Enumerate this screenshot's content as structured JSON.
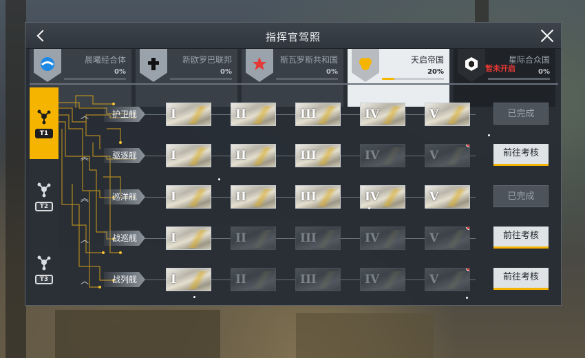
{
  "window": {
    "title": "指挥官驾照"
  },
  "factions": [
    {
      "name": "晨曦经合体",
      "pct": "0%",
      "fill": 0,
      "active": false,
      "emblem": "globe-emblem-icon"
    },
    {
      "name": "新欧罗巴联邦",
      "pct": "0%",
      "fill": 0,
      "active": false,
      "emblem": "cross-emblem-icon"
    },
    {
      "name": "斯瓦罗斯共和国",
      "pct": "0%",
      "fill": 0,
      "active": false,
      "emblem": "star-emblem-icon"
    },
    {
      "name": "天启帝国",
      "pct": "20%",
      "fill": 0.2,
      "active": true,
      "emblem": "circles-emblem-icon"
    },
    {
      "name": "星际合众国",
      "pct": "0%",
      "fill": 0,
      "active": false,
      "emblem": "hexagon-emblem-icon",
      "lock_text": "暂未开启"
    }
  ],
  "tiers": [
    {
      "badge": "T1",
      "active": true
    },
    {
      "badge": "T2",
      "active": false
    },
    {
      "badge": "T3",
      "active": false
    }
  ],
  "numerals": [
    "I",
    "II",
    "III",
    "IV",
    "V"
  ],
  "ships": [
    {
      "name": "护卫舰",
      "chevron": "︿",
      "unlocked": 5,
      "red_dot": null,
      "action": "已完成",
      "action_type": "done"
    },
    {
      "name": "驱逐舰",
      "chevron": "︽",
      "unlocked": 3,
      "red_dot": 4,
      "action": "前往考核",
      "action_type": "go"
    },
    {
      "name": "巡洋舰",
      "chevron": "︽",
      "unlocked": 5,
      "red_dot": null,
      "action": "已完成",
      "action_type": "done"
    },
    {
      "name": "战巡舰",
      "chevron": "︿",
      "unlocked": 1,
      "red_dot": 4,
      "action": "前往考核",
      "action_type": "go"
    },
    {
      "name": "战列舰",
      "chevron": "︿",
      "unlocked": 1,
      "red_dot": 4,
      "action": "前往考核",
      "action_type": "go"
    }
  ],
  "colors": {
    "accent": "#f4b400",
    "alert": "#e53935",
    "panel": "#2d3239"
  }
}
